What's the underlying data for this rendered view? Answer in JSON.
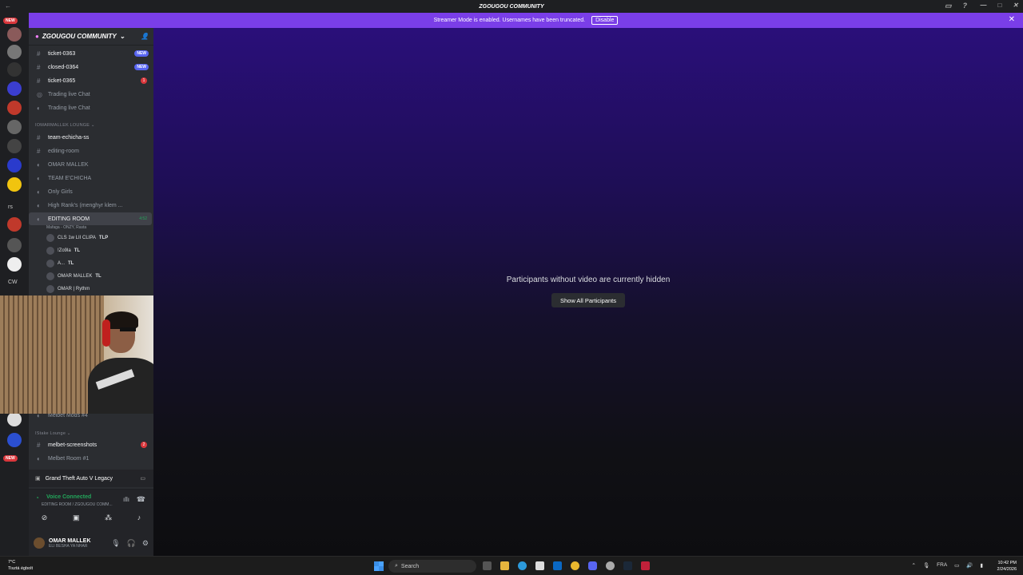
{
  "window": {
    "title": "ZGOUGOU COMMUNITY"
  },
  "banner": {
    "text": "Streamer Mode is enabled. Usernames have been truncated.",
    "button": "Disable"
  },
  "server": {
    "name": "ZGOUGOU COMMUNITY"
  },
  "channels": [
    {
      "name": "ticket-0363",
      "badge": "NEW"
    },
    {
      "name": "closed-0364",
      "badge": "NEW"
    },
    {
      "name": "ticket-0365",
      "count": "1"
    },
    {
      "name": "Trading live Chat"
    },
    {
      "name": "Trading live Chat"
    }
  ],
  "category1": "IOMARMALLEK LOUNGE",
  "lounge": [
    {
      "name": "team-echicha-ss"
    },
    {
      "name": "editing-room"
    },
    {
      "name": "OMAR MALLEK"
    },
    {
      "name": "TEAM E'CHICHA"
    },
    {
      "name": "Only Girls"
    },
    {
      "name": "High Rank's (menghyr klem ..."
    },
    {
      "name": "EDITING ROOM",
      "time": "4:52"
    }
  ],
  "activity": "Mafaga - ONZY, Rasta",
  "voice_users": [
    "CLS 1w LII CLIPA",
    "!Zo9la",
    "A...",
    "OMAR MALLEK",
    "OMAR | Rythm"
  ],
  "voice_tags": [
    "TLP",
    "TL",
    "TL",
    "TL"
  ],
  "category2": "IStake Lounge",
  "lower": [
    {
      "name": "Melbet Mods #4"
    },
    {
      "name": "melbet-screenshots",
      "count": "2"
    },
    {
      "name": "Melbet Room #1"
    }
  ],
  "game": "Grand Theft Auto V Legacy",
  "voice": {
    "status": "Voice Connected",
    "sub": "EDITING ROOM / ZGOUGOU COMM..."
  },
  "user": {
    "name": "OMAR MALLEK",
    "status": "ELI BESHA YA NHAR"
  },
  "stage": {
    "message": "Participants without video are currently hidden",
    "button": "Show All Participants"
  },
  "rail": {
    "new_top": "NEW",
    "new_bottom": "NEW",
    "rs": "rs",
    "cw": "CW"
  },
  "taskbar": {
    "search": "Search",
    "temp": "7°C",
    "weather": "Tisztá égbolt",
    "lang": "FRA",
    "time": "10:42 PM",
    "date": "2/24/2026"
  }
}
